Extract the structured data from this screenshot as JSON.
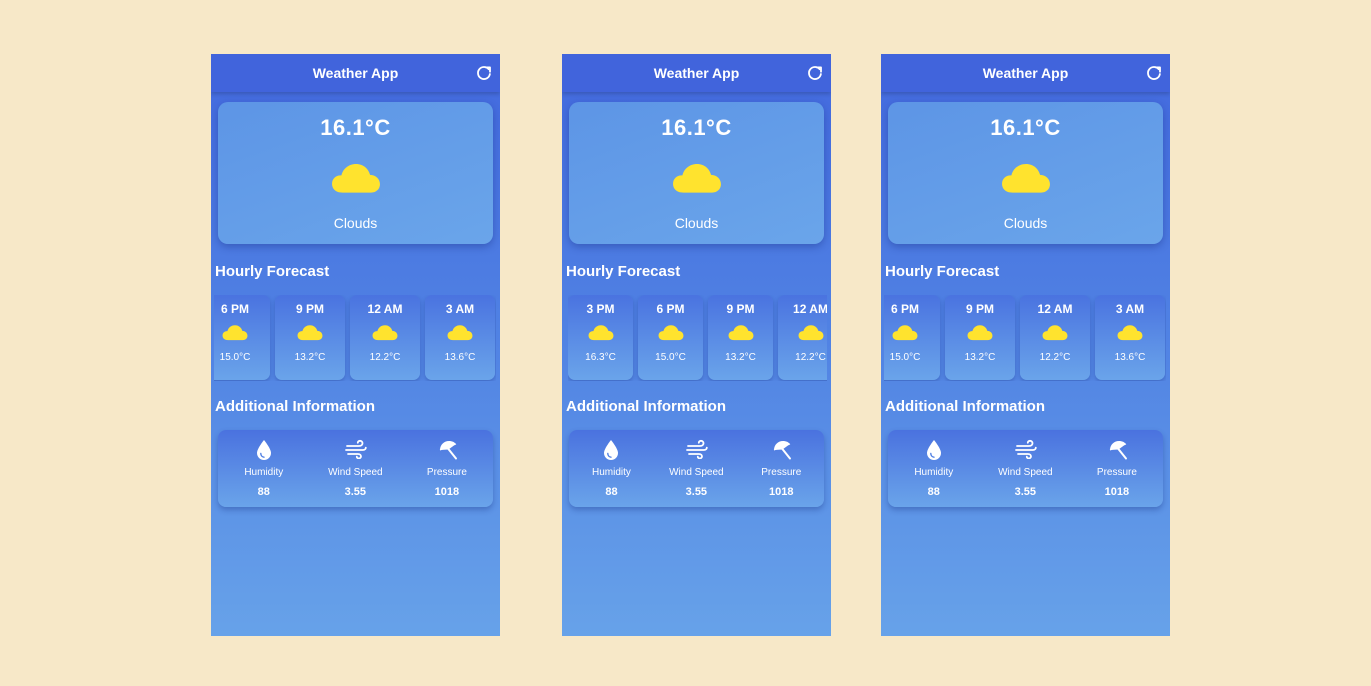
{
  "colors": {
    "background": "#f7e8c8",
    "appbar": "#4164dc",
    "gradient_top": "#4369de",
    "gradient_bottom": "#67a2e9",
    "cloud": "#ffe32e",
    "text": "#ffffff"
  },
  "icons": {
    "refresh": "refresh-icon",
    "weather": "cloud-icon",
    "humidity": "water-drop-icon",
    "wind": "wind-icon",
    "pressure": "umbrella-icon"
  },
  "screens": [
    {
      "app_title": "Weather App",
      "current": {
        "temperature": "16.1°C",
        "condition": "Clouds"
      },
      "hourly_title": "Hourly Forecast",
      "hourly": [
        {
          "time": "6 PM",
          "temp": "15.0°C"
        },
        {
          "time": "9 PM",
          "temp": "13.2°C"
        },
        {
          "time": "12 AM",
          "temp": "12.2°C"
        },
        {
          "time": "3 AM",
          "temp": "13.6°C"
        }
      ],
      "additional_title": "Additional Information",
      "additional": [
        {
          "label": "Humidity",
          "value": "88"
        },
        {
          "label": "Wind Speed",
          "value": "3.55"
        },
        {
          "label": "Pressure",
          "value": "1018"
        }
      ]
    },
    {
      "app_title": "Weather App",
      "current": {
        "temperature": "16.1°C",
        "condition": "Clouds"
      },
      "hourly_title": "Hourly Forecast",
      "hourly": [
        {
          "time": "3 PM",
          "temp": "16.3°C"
        },
        {
          "time": "6 PM",
          "temp": "15.0°C"
        },
        {
          "time": "9 PM",
          "temp": "13.2°C"
        },
        {
          "time": "12 AM",
          "temp": "12.2°C"
        }
      ],
      "additional_title": "Additional Information",
      "additional": [
        {
          "label": "Humidity",
          "value": "88"
        },
        {
          "label": "Wind Speed",
          "value": "3.55"
        },
        {
          "label": "Pressure",
          "value": "1018"
        }
      ]
    },
    {
      "app_title": "Weather App",
      "current": {
        "temperature": "16.1°C",
        "condition": "Clouds"
      },
      "hourly_title": "Hourly Forecast",
      "hourly": [
        {
          "time": "6 PM",
          "temp": "15.0°C"
        },
        {
          "time": "9 PM",
          "temp": "13.2°C"
        },
        {
          "time": "12 AM",
          "temp": "12.2°C"
        },
        {
          "time": "3 AM",
          "temp": "13.6°C"
        }
      ],
      "additional_title": "Additional Information",
      "additional": [
        {
          "label": "Humidity",
          "value": "88"
        },
        {
          "label": "Wind Speed",
          "value": "3.55"
        },
        {
          "label": "Pressure",
          "value": "1018"
        }
      ]
    }
  ]
}
